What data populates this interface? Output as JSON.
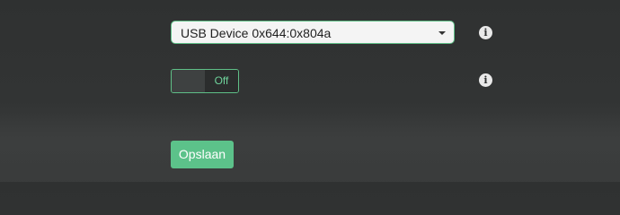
{
  "device_select": {
    "selected_value": "USB Device 0x644:0x804a",
    "caret_icon": "caret-down-icon"
  },
  "info_icons": {
    "glyph": "i",
    "icon": "info-circle-icon"
  },
  "toggle": {
    "state_label": "Off",
    "state": false
  },
  "actions": {
    "save_label": "Opslaan"
  },
  "colors": {
    "accent": "#5cc28a",
    "border_accent": "#5fbf87",
    "background": "#323434"
  }
}
